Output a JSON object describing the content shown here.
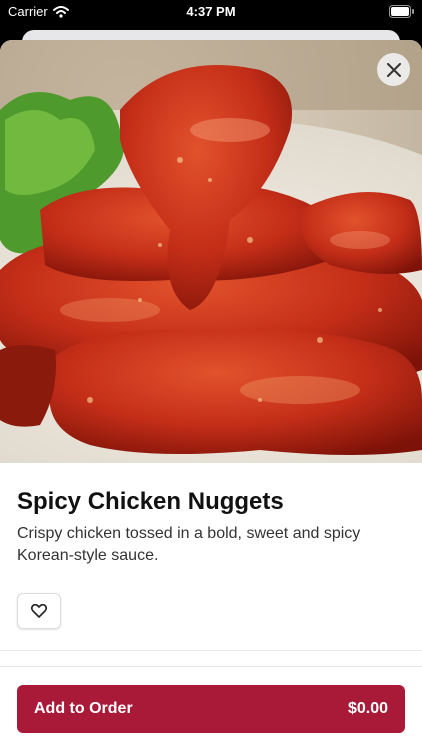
{
  "status_bar": {
    "carrier": "Carrier",
    "time": "4:37 PM"
  },
  "item": {
    "title": "Spicy Chicken Nuggets",
    "description": "Crispy chicken tossed in a bold, sweet and spicy Korean-style sauce."
  },
  "order_button": {
    "label": "Add to Order",
    "price": "$0.00"
  },
  "colors": {
    "accent": "#a91a39"
  },
  "icons": {
    "close": "close-icon",
    "favorite": "heart-icon"
  }
}
